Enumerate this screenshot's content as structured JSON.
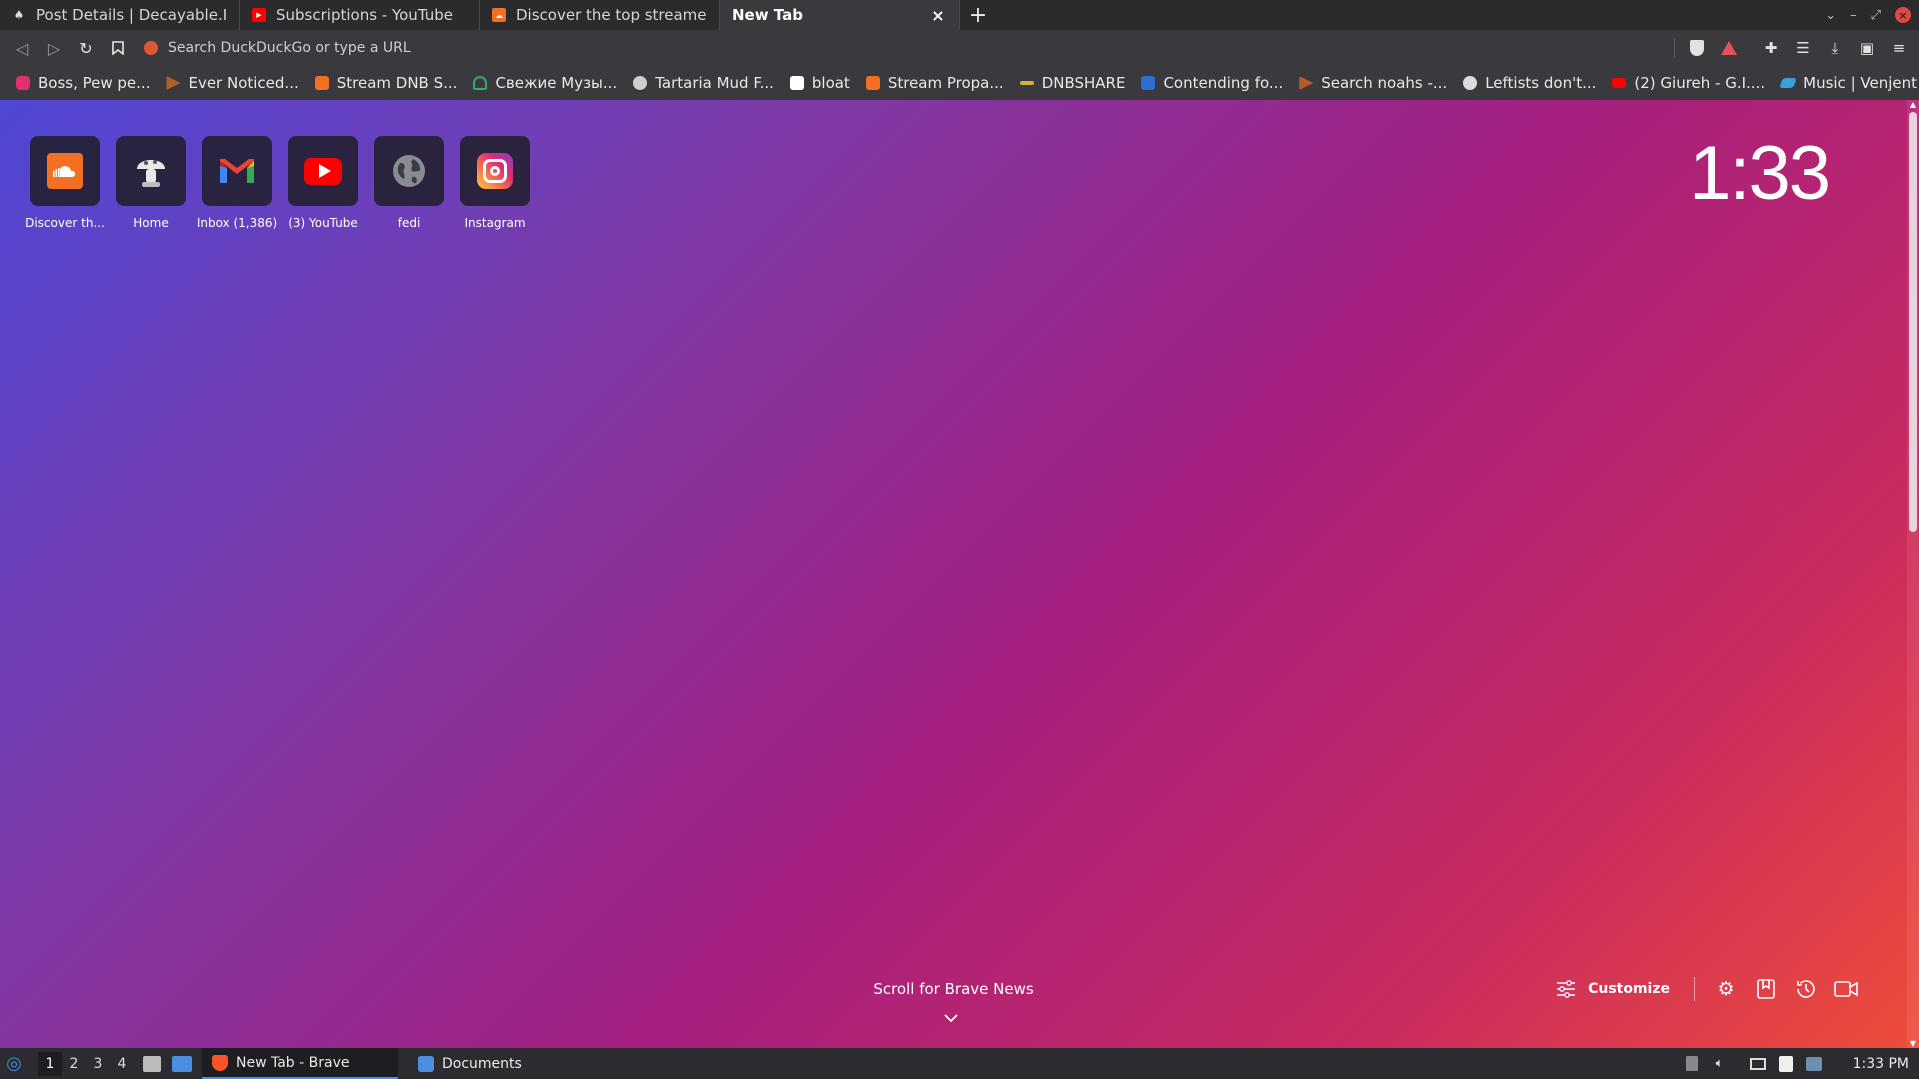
{
  "browser": {
    "tabs": [
      {
        "title": "Post Details | Decayable.Ink",
        "favicon": "mushroom-icon",
        "active": false
      },
      {
        "title": "Subscriptions - YouTube",
        "favicon": "youtube-icon",
        "active": false
      },
      {
        "title": "Discover the top streamed music",
        "favicon": "soundcloud-icon",
        "active": false
      },
      {
        "title": "New Tab",
        "favicon": "",
        "active": true
      }
    ],
    "close_glyph": "×",
    "new_tab_glyph": "+",
    "address_placeholder": "Search DuckDuckGo or type a URL"
  },
  "bookmarks": [
    {
      "label": "Boss, Pew pe...",
      "color": "#e1306c"
    },
    {
      "label": "Ever Noticed...",
      "color": "#b45b2a"
    },
    {
      "label": "Stream DNB S...",
      "color": "#f26f23"
    },
    {
      "label": "Свежие Музы...",
      "color": "#3aa76d"
    },
    {
      "label": "Tartaria Mud F...",
      "color": "#cfcfcf"
    },
    {
      "label": "bloat",
      "color": "#ffffff"
    },
    {
      "label": "Stream Propa...",
      "color": "#f26f23"
    },
    {
      "label": "DNBSHARE",
      "color": "#d4b040"
    },
    {
      "label": "Contending fo...",
      "color": "#2d6fd1"
    },
    {
      "label": "Search noahs -...",
      "color": "#b45b2a"
    },
    {
      "label": "Leftists don't...",
      "color": "#dcdcdc"
    },
    {
      "label": "(2) Giureh - G.I....",
      "color": "#ff0000"
    },
    {
      "label": "Music | Venjent",
      "color": "#3aa0d8"
    }
  ],
  "newtab": {
    "top_sites": [
      {
        "label": "Discover th...",
        "icon": "soundcloud-icon"
      },
      {
        "label": "Home",
        "icon": "mushroom-icon"
      },
      {
        "label": "Inbox (1,386)",
        "icon": "gmail-icon"
      },
      {
        "label": "(3) YouTube",
        "icon": "youtube-icon"
      },
      {
        "label": "fedi",
        "icon": "globe-icon"
      },
      {
        "label": "Instagram",
        "icon": "instagram-icon"
      }
    ],
    "clock": "1:33",
    "news_prompt": "Scroll for Brave News",
    "customize_label": "Customize"
  },
  "taskbar": {
    "workspaces": [
      "1",
      "2",
      "3",
      "4"
    ],
    "tasks": [
      {
        "label": "New Tab - Brave",
        "icon": "brave-icon",
        "active": true
      },
      {
        "label": "Documents",
        "icon": "folder-icon",
        "active": false
      }
    ],
    "time": "1:33 PM"
  }
}
